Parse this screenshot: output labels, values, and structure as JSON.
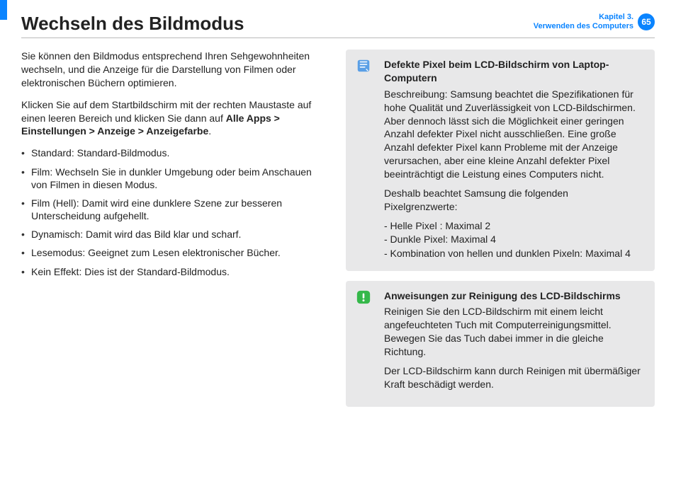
{
  "header": {
    "title": "Wechseln des Bildmodus",
    "chapter_line1": "Kapitel 3.",
    "chapter_line2": "Verwenden des Computers",
    "page_number": "65"
  },
  "left": {
    "intro1": "Sie können den Bildmodus entsprechend Ihren Sehgewohnheiten wechseln, und die Anzeige für die Darstellung von Filmen oder elektronischen Büchern optimieren.",
    "intro2_pre": "Klicken Sie auf dem Startbildschirm mit der rechten Maustaste auf einen leeren Bereich und klicken Sie dann auf ",
    "intro2_bold": "Alle Apps > Einstellungen > Anzeige > Anzeigefarbe",
    "intro2_post": ".",
    "modes": [
      "Standard: Standard-Bildmodus.",
      "Film: Wechseln Sie in dunkler Umgebung oder beim Anschauen von Filmen in diesen Modus.",
      "Film (Hell): Damit wird eine dunklere Szene zur besseren Unterscheidung aufgehellt.",
      "Dynamisch: Damit wird das Bild klar und scharf.",
      "Lesemodus: Geeignet zum Lesen elektronischer Bücher.",
      "Kein Effekt: Dies ist der Standard-Bildmodus."
    ]
  },
  "box1": {
    "title": "Defekte Pixel beim LCD-Bildschirm von Laptop-Computern",
    "para1": "Beschreibung: Samsung beachtet die Spezifikationen für hohe Qualität und Zuverlässigkeit von LCD-Bildschirmen. Aber dennoch lässt sich die Möglichkeit einer geringen Anzahl defekter Pixel nicht ausschließen. Eine große Anzahl defekter Pixel kann Probleme mit der Anzeige verursachen, aber eine kleine Anzahl defekter Pixel beeinträchtigt die Leistung eines Computers nicht.",
    "para2": "Deshalb beachtet Samsung die folgenden Pixelgrenzwerte:",
    "limit1": "- Helle Pixel : Maximal 2",
    "limit2": "- Dunkle Pixel: Maximal 4",
    "limit3": "- Kombination von hellen und dunklen Pixeln: Maximal 4"
  },
  "box2": {
    "title": "Anweisungen zur Reinigung des LCD-Bildschirms",
    "para1": "Reinigen Sie den LCD-Bildschirm mit einem leicht angefeuchteten Tuch mit Computerreinigungsmittel. Bewegen Sie das Tuch dabei immer in die gleiche Richtung.",
    "para2": "Der LCD-Bildschirm kann durch Reinigen mit übermäßiger Kraft beschädigt werden."
  }
}
